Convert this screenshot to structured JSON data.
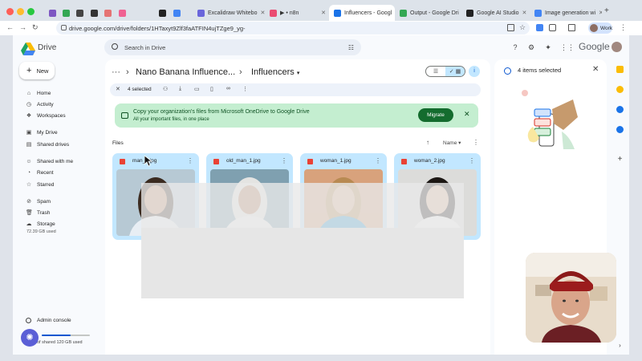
{
  "browser": {
    "tabs": [
      {
        "label": "",
        "color": "#7e57c2"
      },
      {
        "label": "",
        "color": "#34a853"
      },
      {
        "label": "",
        "color": "#444444"
      },
      {
        "label": "",
        "color": "#333333"
      },
      {
        "label": "",
        "color": "#e57373"
      },
      {
        "label": "",
        "color": "#f06292"
      },
      {
        "label": "",
        "color": "#222222"
      },
      {
        "label": "",
        "color": "#4285f4"
      },
      {
        "label": "Excalidraw Whitebo",
        "color": "#6965db"
      },
      {
        "label": "▶ • n8n",
        "color": "#ea4b71"
      },
      {
        "label": "Influencers - Googl",
        "color": "#1a73e8",
        "active": true
      },
      {
        "label": "Output - Google Dri",
        "color": "#34a853"
      },
      {
        "label": "Google AI Studio",
        "color": "#222222"
      },
      {
        "label": "Image generation wi",
        "color": "#4285f4"
      }
    ],
    "url": "drive.google.com/drive/folders/1HTaxyt9Zlf3faATFIN4ujTZge9_yg-",
    "profile_label": "Work"
  },
  "drive": {
    "app_name": "Drive",
    "search_placeholder": "Search in Drive",
    "google_word": "Google",
    "new_label": "New",
    "nav": [
      {
        "label": "Home",
        "icon": "home-icon",
        "glyph": "⌂"
      },
      {
        "label": "Activity",
        "icon": "activity-icon",
        "glyph": "◷"
      },
      {
        "label": "Workspaces",
        "icon": "workspaces-icon",
        "glyph": "❖"
      },
      {
        "label": "My Drive",
        "icon": "my-drive-icon",
        "glyph": "▣"
      },
      {
        "label": "Shared drives",
        "icon": "shared-drives-icon",
        "glyph": "▤"
      },
      {
        "label": "Shared with me",
        "icon": "shared-with-me-icon",
        "glyph": "☺"
      },
      {
        "label": "Recent",
        "icon": "recent-icon",
        "glyph": "◔"
      },
      {
        "label": "Starred",
        "icon": "star-icon",
        "glyph": "☆"
      },
      {
        "label": "Spam",
        "icon": "spam-icon",
        "glyph": "⊘"
      },
      {
        "label": "Trash",
        "icon": "trash-icon",
        "glyph": "🗑"
      },
      {
        "label": "Storage",
        "icon": "cloud-icon",
        "glyph": "☁"
      }
    ],
    "storage_used": "72.39 GB used",
    "admin_console": "Admin console",
    "shared_storage": "of shared 120 GB used",
    "shared_storage_fraction": 0.6,
    "breadcrumb_parent": "Nano Banana Influence...",
    "breadcrumb_current": "Influencers",
    "selection_count": "4 selected",
    "banner": {
      "title": "Copy your organization's files from Microsoft OneDrive to Google Drive",
      "subtitle": "All your important files, in one place",
      "button": "Migrate"
    },
    "files_heading": "Files",
    "sort_label": "Name",
    "files": [
      {
        "name": "man_1.jpg",
        "bg": "#b7c9d4",
        "skin": "#c9926e",
        "shirt": "#e8eef4",
        "hair": "#3b2b20"
      },
      {
        "name": "old_man_1.jpg",
        "bg": "#7fa0b0",
        "skin": "#b98462",
        "shirt": "#f1f1ef",
        "hair": "#e4e4e2"
      },
      {
        "name": "woman_1.jpg",
        "bg": "#d8a27c",
        "skin": "#e0b292",
        "shirt": "#2e9ad0",
        "hair": "#b88a52"
      },
      {
        "name": "woman_2.jpg",
        "bg": "#dcdcda",
        "skin": "#e2b79b",
        "shirt": "#f5f5f5",
        "hair": "#1c1714"
      }
    ],
    "details_title": "4 items selected"
  }
}
